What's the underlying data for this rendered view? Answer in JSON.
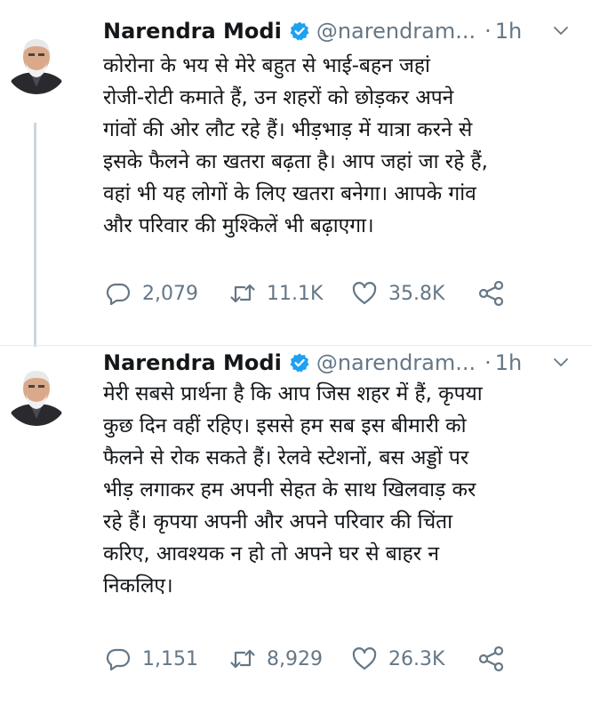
{
  "tweets": [
    {
      "author_name": "Narendra Modi",
      "handle": "@narendram...",
      "separator": "·",
      "time": "1h",
      "text": "कोरोना के भय से मेरे बहुत से भाई-बहन जहां\nरोजी-रोटी कमाते हैं, उन शहरों को छोड़कर अपने\nगांवों की ओर लौट रहे हैं। भीड़भाड़ में यात्रा करने से\nइसके फैलने का खतरा बढ़ता है। आप जहां जा रहे हैं,\nवहां भी यह लोगों के लिए खतरा बनेगा। आपके गांव\nऔर परिवार की मुश्किलें भी बढ़ाएगा।",
      "replies": "2,079",
      "retweets": "11.1K",
      "likes": "35.8K"
    },
    {
      "author_name": "Narendra Modi",
      "handle": "@narendram...",
      "separator": "·",
      "time": "1h",
      "text": "मेरी सबसे प्रार्थना है कि आप जिस शहर में हैं, कृपया\nकुछ दिन वहीं रहिए। इससे हम सब इस बीमारी को\nफैलने से रोक सकते हैं। रेलवे स्टेशनों, बस अड्डों पर\nभीड़ लगाकर हम अपनी सेहत के साथ खिलवाड़ कर\nरहे हैं। कृपया अपनी और अपने परिवार की चिंता\nकरिए, आवश्यक न हो तो अपने घर से बाहर न\nनिकलिए।",
      "replies": "1,151",
      "retweets": "8,929",
      "likes": "26.3K"
    }
  ],
  "icons": {
    "verified": "verified-badge-icon",
    "menu": "chevron-down-icon",
    "reply": "reply-bubble-icon",
    "retweet": "retweet-arrows-icon",
    "like": "heart-outline-icon",
    "share": "share-icon"
  },
  "colors": {
    "text": "#14171a",
    "secondary": "#657786",
    "verified": "#1da1f2",
    "thread_line": "#ccd6dd"
  }
}
